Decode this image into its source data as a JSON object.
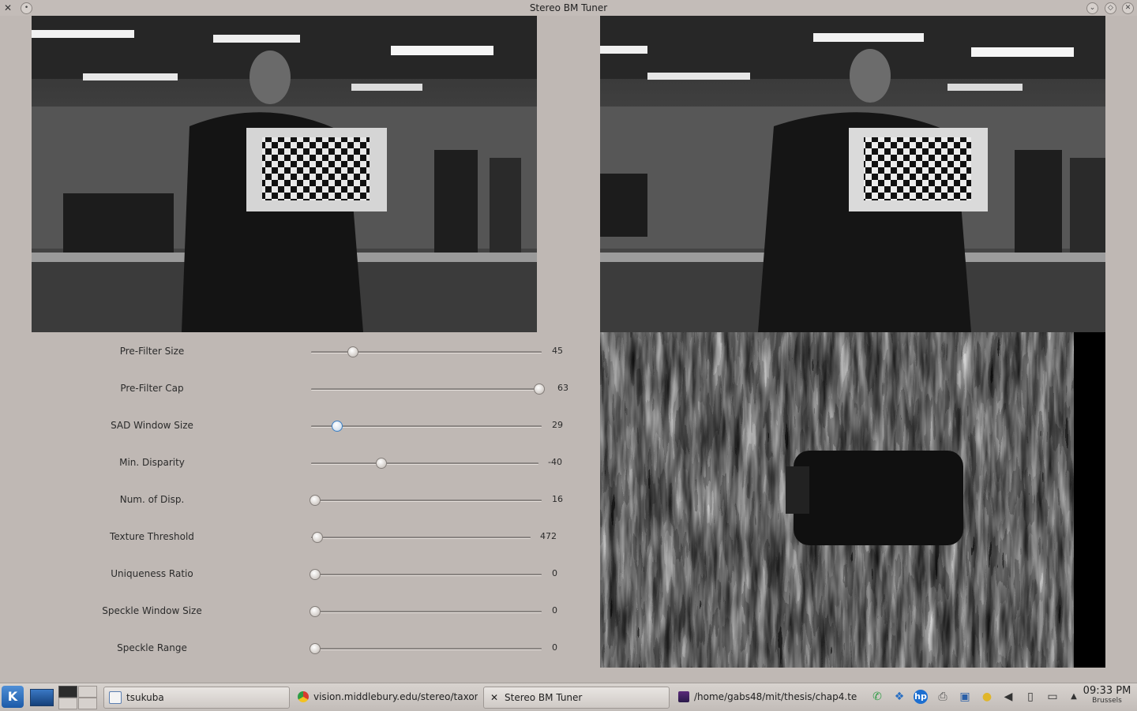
{
  "window": {
    "title": "Stereo BM Tuner"
  },
  "sliders": [
    {
      "label": "Pre-Filter Size",
      "value": "45",
      "fraction": 0.17
    },
    {
      "label": "Pre-Filter Cap",
      "value": "63",
      "fraction": 1.0
    },
    {
      "label": "SAD Window Size",
      "value": "29",
      "fraction": 0.1
    },
    {
      "label": "Min. Disparity",
      "value": "-40",
      "fraction": 0.3
    },
    {
      "label": "Num. of Disp.",
      "value": "16",
      "fraction": 0.0
    },
    {
      "label": "Texture Threshold",
      "value": "472",
      "fraction": 0.01
    },
    {
      "label": "Uniqueness Ratio",
      "value": "0",
      "fraction": 0.0
    },
    {
      "label": "Speckle Window Size",
      "value": "0",
      "fraction": 0.0
    },
    {
      "label": "Speckle Range",
      "value": "0",
      "fraction": 0.0
    }
  ],
  "taskbar": {
    "tasks": [
      {
        "label": "tsukuba",
        "icon": "window-icon"
      },
      {
        "label": "vision.middlebury.edu/stereo/taxon",
        "icon": "chrome-icon"
      },
      {
        "label": "Stereo BM Tuner",
        "icon": "x-icon"
      },
      {
        "label": "/home/gabs48/mit/thesis/chap4.te",
        "icon": "editor-icon"
      }
    ],
    "tray_icons": [
      "chat-icon",
      "dropbox-icon",
      "hp-icon",
      "printer-icon",
      "network-icon",
      "bulb-icon",
      "volume-icon",
      "clipboard-icon",
      "monitor-icon",
      "arrow-up-icon"
    ],
    "clock_time": "09:33 PM",
    "clock_city": "Brussels"
  }
}
